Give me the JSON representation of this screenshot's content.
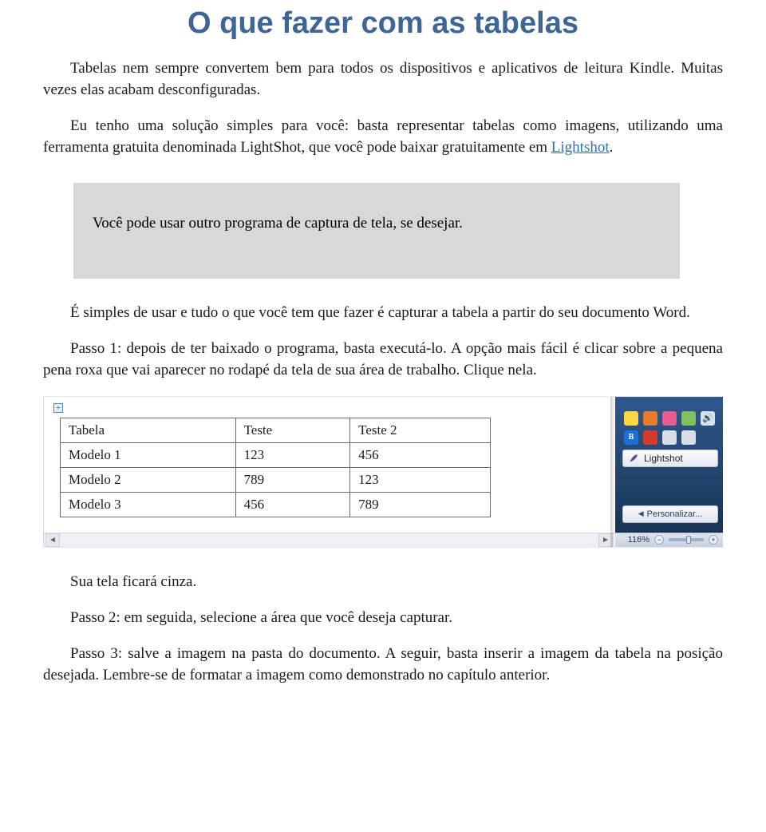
{
  "heading": "O que fazer com as tabelas",
  "p1": "Tabelas nem sempre convertem bem para todos os dispositivos e aplicativos de leitura Kindle. Muitas vezes elas acabam desconfiguradas.",
  "p2a": "Eu tenho uma solução simples para você: basta representar tabelas como imagens, utilizando uma ferramenta gratuita denominada LightShot, que você pode baixar gratuitamente em ",
  "p2_link": "Lightshot",
  "p2b": ".",
  "callout": "Você pode usar outro programa de captura de tela, se desejar.",
  "p3": "É simples de usar e tudo o que você tem que fazer é capturar a tabela a partir do seu documento Word.",
  "p4": "Passo 1: depois de ter baixado o programa, basta executá-lo. A opção mais fácil é clicar sobre a pequena pena roxa que vai aparecer no rodapé da tela de sua área de trabalho. Clique nela.",
  "figure": {
    "plus": "+",
    "table": {
      "headers": [
        "Tabela",
        "Teste",
        "Teste 2"
      ],
      "rows": [
        [
          "Modelo 1",
          "123",
          "456"
        ],
        [
          "Modelo 2",
          "789",
          "123"
        ],
        [
          "Modelo 3",
          "456",
          "789"
        ]
      ]
    },
    "lightshot_label": "Lightshot",
    "personalize_label": "Personalizar...",
    "tray": {
      "bluetooth": "B",
      "speaker": "🔊"
    },
    "zoom": {
      "value": "116%",
      "minus": "−",
      "plus": "+"
    },
    "scroll": {
      "left": "◄",
      "right": "►"
    }
  },
  "p5": "Sua tela ficará cinza.",
  "p6": "Passo 2: em seguida, selecione a área que você deseja capturar.",
  "p7": "Passo 3: salve a imagem na pasta do documento. A seguir, basta inserir a imagem da tabela na posição desejada. Lembre-se de formatar a imagem como demonstrado no capítulo anterior."
}
